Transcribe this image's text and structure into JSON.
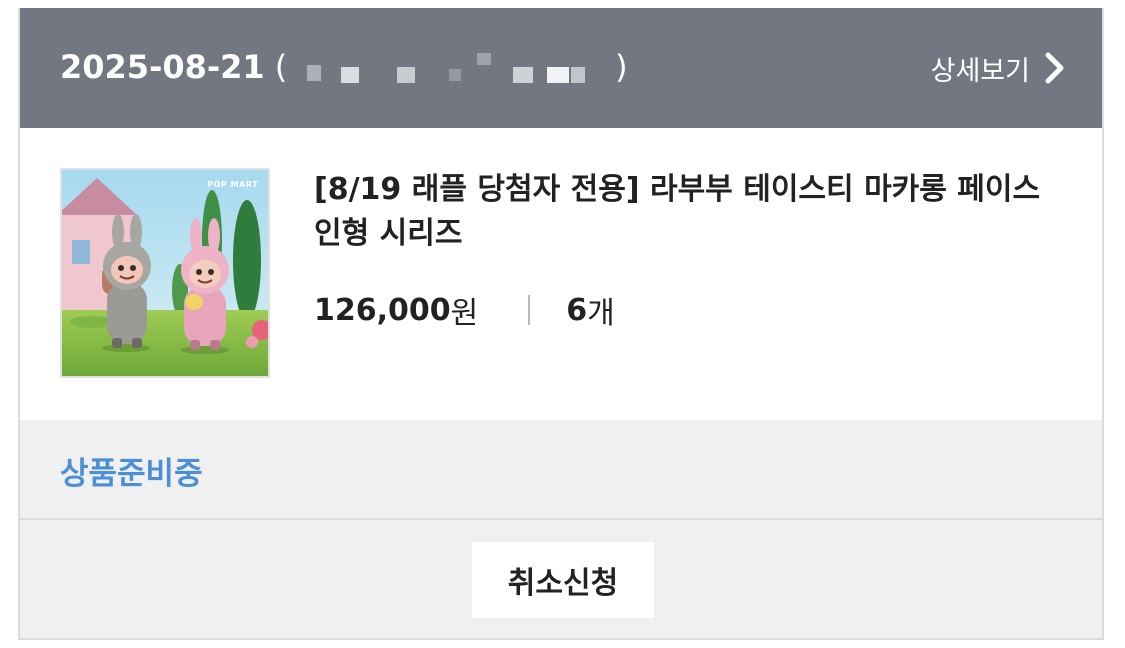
{
  "order": {
    "date": "2025-08-21",
    "paren_open": "(",
    "paren_close": ")",
    "detail_link_label": "상세보기"
  },
  "product": {
    "title_line1": "[8/19 래플 당첨자 전용] 라부부 테이스티 마카롱 페이스",
    "title_line2": "인형 시리즈",
    "price": "126,000",
    "price_unit": "원",
    "quantity": "6",
    "quantity_unit": "개",
    "thumbnail_brand": "POP MART"
  },
  "status": {
    "label": "상품준비중"
  },
  "actions": {
    "cancel_label": "취소신청"
  },
  "colors": {
    "header_bg": "#737781",
    "status_text": "#4a8fd8",
    "section_bg": "#f0f0f0"
  },
  "icons": {
    "detail_arrow": "chevron-right-icon"
  }
}
